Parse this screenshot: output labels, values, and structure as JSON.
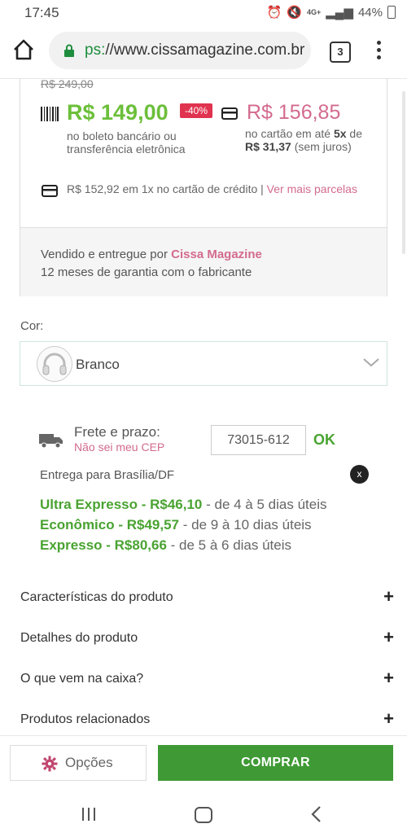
{
  "status_bar": {
    "time": "17:45",
    "battery": "44%",
    "network": "4G+"
  },
  "browser": {
    "url_scheme": "ps:",
    "url_rest": "//www.cissamagazine.com.br",
    "tab_count": "3"
  },
  "price": {
    "old_price": "R$ 249,00",
    "price": "R$ 149,00",
    "discount": "-40%",
    "boleto_note": "no boleto bancário ou transferência eletrônica",
    "card_price": "R$ 156,85",
    "card_terms_prefix": "no cartão em até ",
    "card_installments": "5x",
    "card_terms_mid": " de ",
    "card_installment_value": "R$ 31,37",
    "card_terms_suffix": " (sem juros)",
    "credit_text": "R$ 152,92 em 1x no cartão de crédito | ",
    "credit_link": "Ver mais parcelas",
    "seller_prefix": "Vendido e entregue por ",
    "seller_name": "Cissa Magazine",
    "warranty": "12 meses de garantia com o fabricante"
  },
  "color": {
    "label": "Cor:",
    "value": "Branco"
  },
  "shipping": {
    "label": "Frete e prazo:",
    "cep_link": "Não sei meu CEP",
    "cep_value": "73015-612",
    "ok_label": "OK",
    "destination": "Entrega para Brasília/DF",
    "close_label": "x",
    "options": [
      {
        "name": "Ultra Expresso - R$46,10",
        "detail": " - de 4 à  5 dias úteis"
      },
      {
        "name": "Econômico - R$49,57",
        "detail": " - de 9 à  10 dias úteis"
      },
      {
        "name": "Expresso - R$80,66",
        "detail": " - de 5 à  6 dias úteis"
      }
    ]
  },
  "accordions": [
    {
      "label": "Características do produto",
      "icon": "+"
    },
    {
      "label": "Detalhes do produto",
      "icon": "+"
    },
    {
      "label": "O que vem na caixa?",
      "icon": "+"
    },
    {
      "label": "Produtos relacionados",
      "icon": "+"
    }
  ],
  "actions": {
    "options_label": "Opções",
    "buy_label": "COMPRAR"
  },
  "colors": {
    "green": "#3f9a35",
    "price_green": "#6cbf3a",
    "pink": "#d36b8e",
    "discount_red": "#e0334f"
  }
}
